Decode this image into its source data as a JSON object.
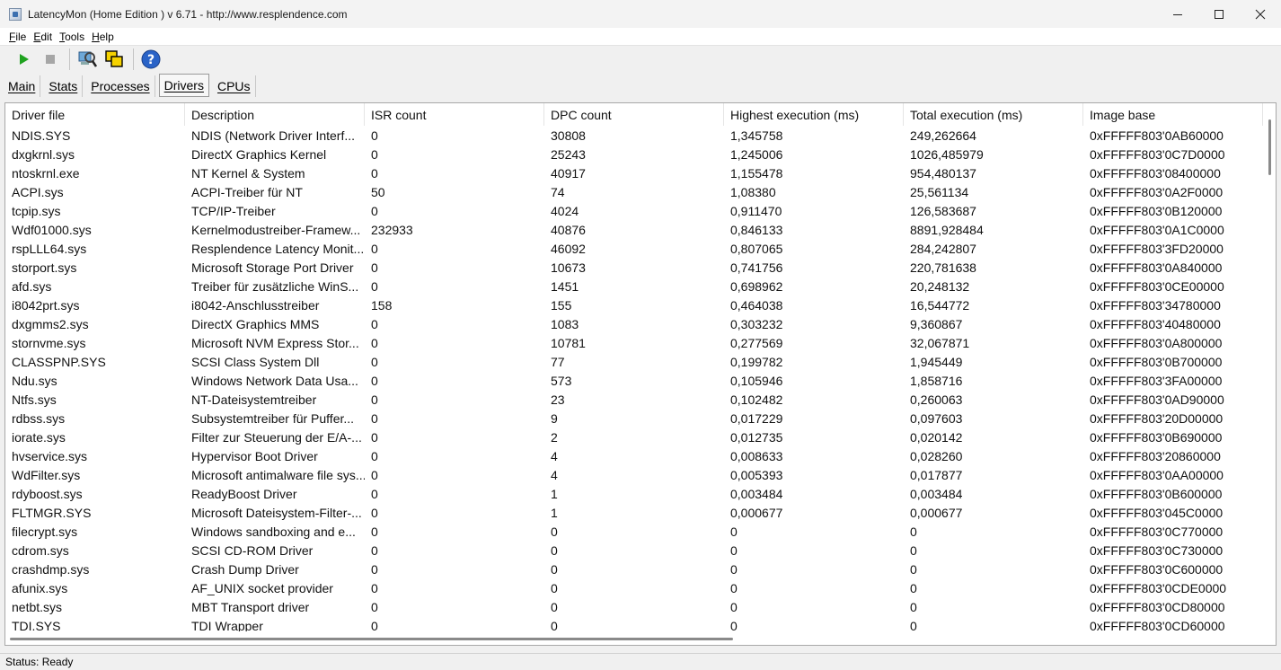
{
  "window": {
    "title": "LatencyMon  (Home Edition )  v 6.71 - http://www.resplendence.com"
  },
  "menu": [
    {
      "key": "F",
      "rest": "ile"
    },
    {
      "key": "E",
      "rest": "dit"
    },
    {
      "key": "T",
      "rest": "ools"
    },
    {
      "key": "H",
      "rest": "elp"
    }
  ],
  "toolbar": {
    "icons": [
      "play-icon",
      "stop-icon",
      "magnifier-icon",
      "windows-icon",
      "help-icon"
    ]
  },
  "tabs": [
    {
      "label": "Main",
      "active": false
    },
    {
      "label": "Stats",
      "active": false
    },
    {
      "label": "Processes",
      "active": false
    },
    {
      "label": "Drivers",
      "active": true
    },
    {
      "label": "CPUs",
      "active": false
    }
  ],
  "table": {
    "columns": [
      "Driver file",
      "Description",
      "ISR count",
      "DPC count",
      "Highest execution (ms)",
      "Total execution (ms)",
      "Image base"
    ],
    "rows": [
      [
        "NDIS.SYS",
        "NDIS (Network Driver Interf...",
        "0",
        "30808",
        "1,345758",
        "249,262664",
        "0xFFFFF803'0AB60000"
      ],
      [
        "dxgkrnl.sys",
        "DirectX Graphics Kernel",
        "0",
        "25243",
        "1,245006",
        "1026,485979",
        "0xFFFFF803'0C7D0000"
      ],
      [
        "ntoskrnl.exe",
        "NT Kernel & System",
        "0",
        "40917",
        "1,155478",
        "954,480137",
        "0xFFFFF803'08400000"
      ],
      [
        "ACPI.sys",
        "ACPI-Treiber für NT",
        "50",
        "74",
        "1,08380",
        "25,561134",
        "0xFFFFF803'0A2F0000"
      ],
      [
        "tcpip.sys",
        "TCP/IP-Treiber",
        "0",
        "4024",
        "0,911470",
        "126,583687",
        "0xFFFFF803'0B120000"
      ],
      [
        "Wdf01000.sys",
        "Kernelmodustreiber-Framew...",
        "232933",
        "40876",
        "0,846133",
        "8891,928484",
        "0xFFFFF803'0A1C0000"
      ],
      [
        "rspLLL64.sys",
        "Resplendence Latency Monit...",
        "0",
        "46092",
        "0,807065",
        "284,242807",
        "0xFFFFF803'3FD20000"
      ],
      [
        "storport.sys",
        "Microsoft Storage Port Driver",
        "0",
        "10673",
        "0,741756",
        "220,781638",
        "0xFFFFF803'0A840000"
      ],
      [
        "afd.sys",
        "Treiber für zusätzliche WinS...",
        "0",
        "1451",
        "0,698962",
        "20,248132",
        "0xFFFFF803'0CE00000"
      ],
      [
        "i8042prt.sys",
        "i8042-Anschlusstreiber",
        "158",
        "155",
        "0,464038",
        "16,544772",
        "0xFFFFF803'34780000"
      ],
      [
        "dxgmms2.sys",
        "DirectX Graphics MMS",
        "0",
        "1083",
        "0,303232",
        "9,360867",
        "0xFFFFF803'40480000"
      ],
      [
        "stornvme.sys",
        "Microsoft NVM Express Stor...",
        "0",
        "10781",
        "0,277569",
        "32,067871",
        "0xFFFFF803'0A800000"
      ],
      [
        "CLASSPNP.SYS",
        "SCSI Class System Dll",
        "0",
        "77",
        "0,199782",
        "1,945449",
        "0xFFFFF803'0B700000"
      ],
      [
        "Ndu.sys",
        "Windows Network Data Usa...",
        "0",
        "573",
        "0,105946",
        "1,858716",
        "0xFFFFF803'3FA00000"
      ],
      [
        "Ntfs.sys",
        "NT-Dateisystemtreiber",
        "0",
        "23",
        "0,102482",
        "0,260063",
        "0xFFFFF803'0AD90000"
      ],
      [
        "rdbss.sys",
        "Subsystemtreiber für Puffer...",
        "0",
        "9",
        "0,017229",
        "0,097603",
        "0xFFFFF803'20D00000"
      ],
      [
        "iorate.sys",
        "Filter zur Steuerung der E/A-...",
        "0",
        "2",
        "0,012735",
        "0,020142",
        "0xFFFFF803'0B690000"
      ],
      [
        "hvservice.sys",
        "Hypervisor Boot Driver",
        "0",
        "4",
        "0,008633",
        "0,028260",
        "0xFFFFF803'20860000"
      ],
      [
        "WdFilter.sys",
        "Microsoft antimalware file sys...",
        "0",
        "4",
        "0,005393",
        "0,017877",
        "0xFFFFF803'0AA00000"
      ],
      [
        "rdyboost.sys",
        "ReadyBoost Driver",
        "0",
        "1",
        "0,003484",
        "0,003484",
        "0xFFFFF803'0B600000"
      ],
      [
        "FLTMGR.SYS",
        "Microsoft Dateisystem-Filter-...",
        "0",
        "1",
        "0,000677",
        "0,000677",
        "0xFFFFF803'045C0000"
      ],
      [
        "filecrypt.sys",
        "Windows sandboxing and e...",
        "0",
        "0",
        "0",
        "0",
        "0xFFFFF803'0C770000"
      ],
      [
        "cdrom.sys",
        "SCSI CD-ROM Driver",
        "0",
        "0",
        "0",
        "0",
        "0xFFFFF803'0C730000"
      ],
      [
        "crashdmp.sys",
        "Crash Dump Driver",
        "0",
        "0",
        "0",
        "0",
        "0xFFFFF803'0C600000"
      ],
      [
        "afunix.sys",
        "AF_UNIX socket provider",
        "0",
        "0",
        "0",
        "0",
        "0xFFFFF803'0CDE0000"
      ],
      [
        "netbt.sys",
        "MBT Transport driver",
        "0",
        "0",
        "0",
        "0",
        "0xFFFFF803'0CD80000"
      ],
      [
        "TDI.SYS",
        "TDI Wrapper",
        "0",
        "0",
        "0",
        "0",
        "0xFFFFF803'0CD60000"
      ]
    ]
  },
  "status": {
    "text": "Status: Ready"
  }
}
